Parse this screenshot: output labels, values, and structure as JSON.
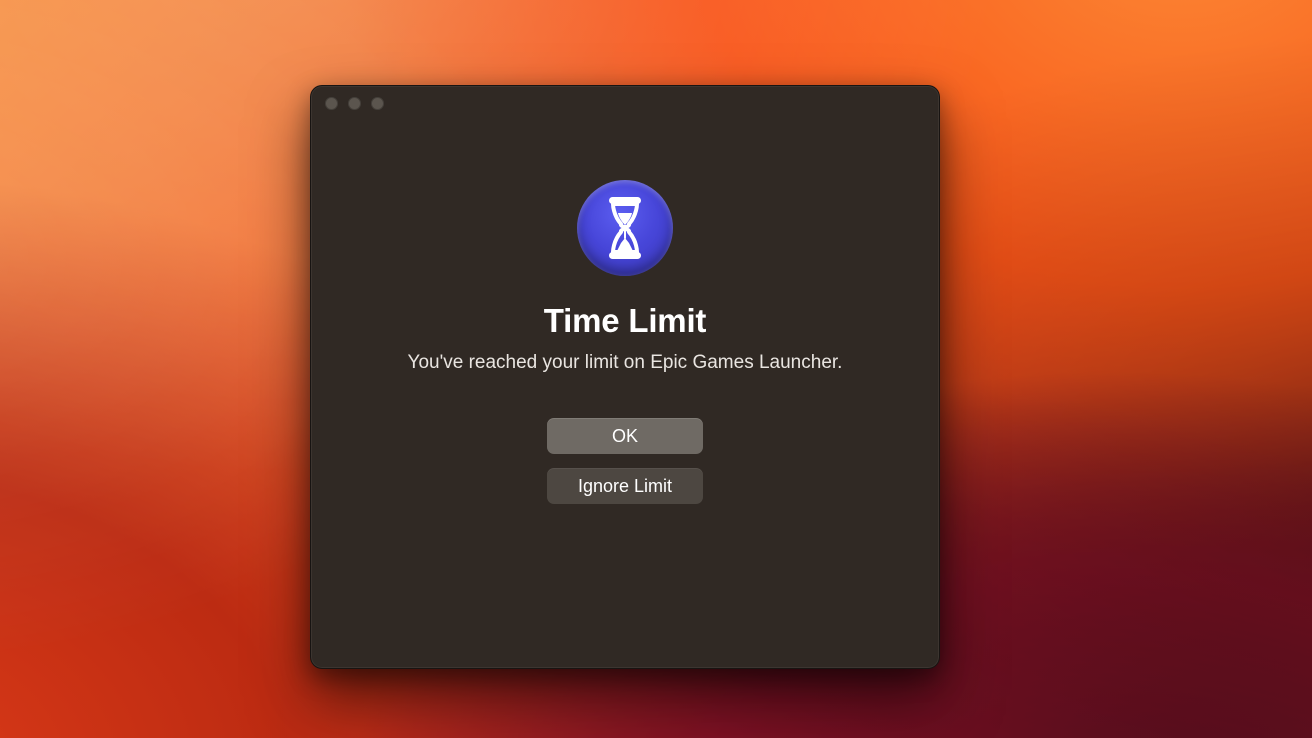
{
  "dialog": {
    "icon_name": "hourglass-icon",
    "title": "Time Limit",
    "message": "You've reached your limit on Epic Games Launcher.",
    "buttons": {
      "ok_label": "OK",
      "ignore_label": "Ignore Limit"
    }
  },
  "colors": {
    "window_background": "#302924",
    "icon_background": "#4746d9",
    "primary_button": "#6f6a64",
    "secondary_button": "#4d4741"
  }
}
